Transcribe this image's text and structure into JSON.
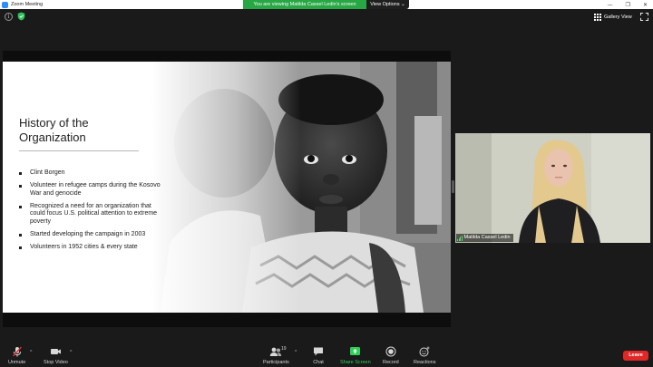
{
  "window": {
    "title": "Zoom Meeting",
    "controls": [
      "—",
      "❐",
      "✕"
    ]
  },
  "share_banner": {
    "text": "You are viewing Matilda Cassel Ledin's screen",
    "view_options": "View Options ⌄"
  },
  "topbar": {
    "gallery_view": "Gallery View"
  },
  "slide": {
    "title_line1": "History of the",
    "title_line2": "Organization",
    "bullets": [
      "Clint Borgen",
      "Volunteer in refugee camps during the Kosovo War and genocide",
      "Recognized a need for an organization that could focus U.S. political attention to extreme poverty",
      "Started developing the campaign in 2003",
      "Volunteers in 1952 cities & every state"
    ]
  },
  "participant": {
    "name": "Matilda Cassel Ledin"
  },
  "toolbar": {
    "unmute": "Unmute",
    "stop_video": "Stop Video",
    "participants": "Participants",
    "participants_count": "19",
    "chat": "Chat",
    "share_screen": "Share Screen",
    "record": "Record",
    "reactions": "Reactions",
    "leave": "Leave",
    "caret": "^"
  },
  "colors": {
    "share_green": "#28a745",
    "leave_red": "#e02828",
    "zoom_blue": "#2d8cff"
  }
}
